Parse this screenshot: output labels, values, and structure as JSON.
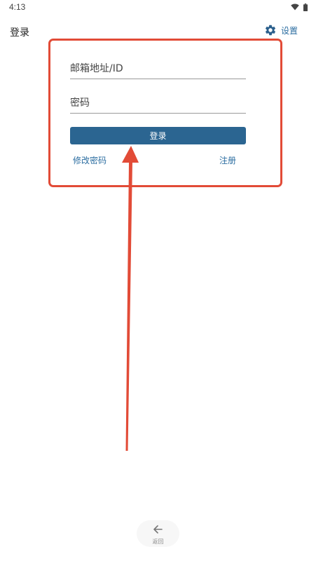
{
  "status_bar": {
    "time": "4:13",
    "icons": [
      "wifi-icon",
      "battery-icon"
    ]
  },
  "header": {
    "title": "登录",
    "settings_label": "设置",
    "settings_icon": "gear-icon"
  },
  "login_form": {
    "email_placeholder": "邮箱地址/ID",
    "email_value": "",
    "password_placeholder": "密码",
    "password_value": "",
    "login_button": "登录",
    "forgot_password_link": "修改密码",
    "register_link": "注册"
  },
  "bottom_nav": {
    "back_label": "返回",
    "back_icon": "arrow-left-icon"
  },
  "colors": {
    "accent": "#2b6591",
    "link": "#2c6ea1",
    "annotation": "#e24b37"
  }
}
